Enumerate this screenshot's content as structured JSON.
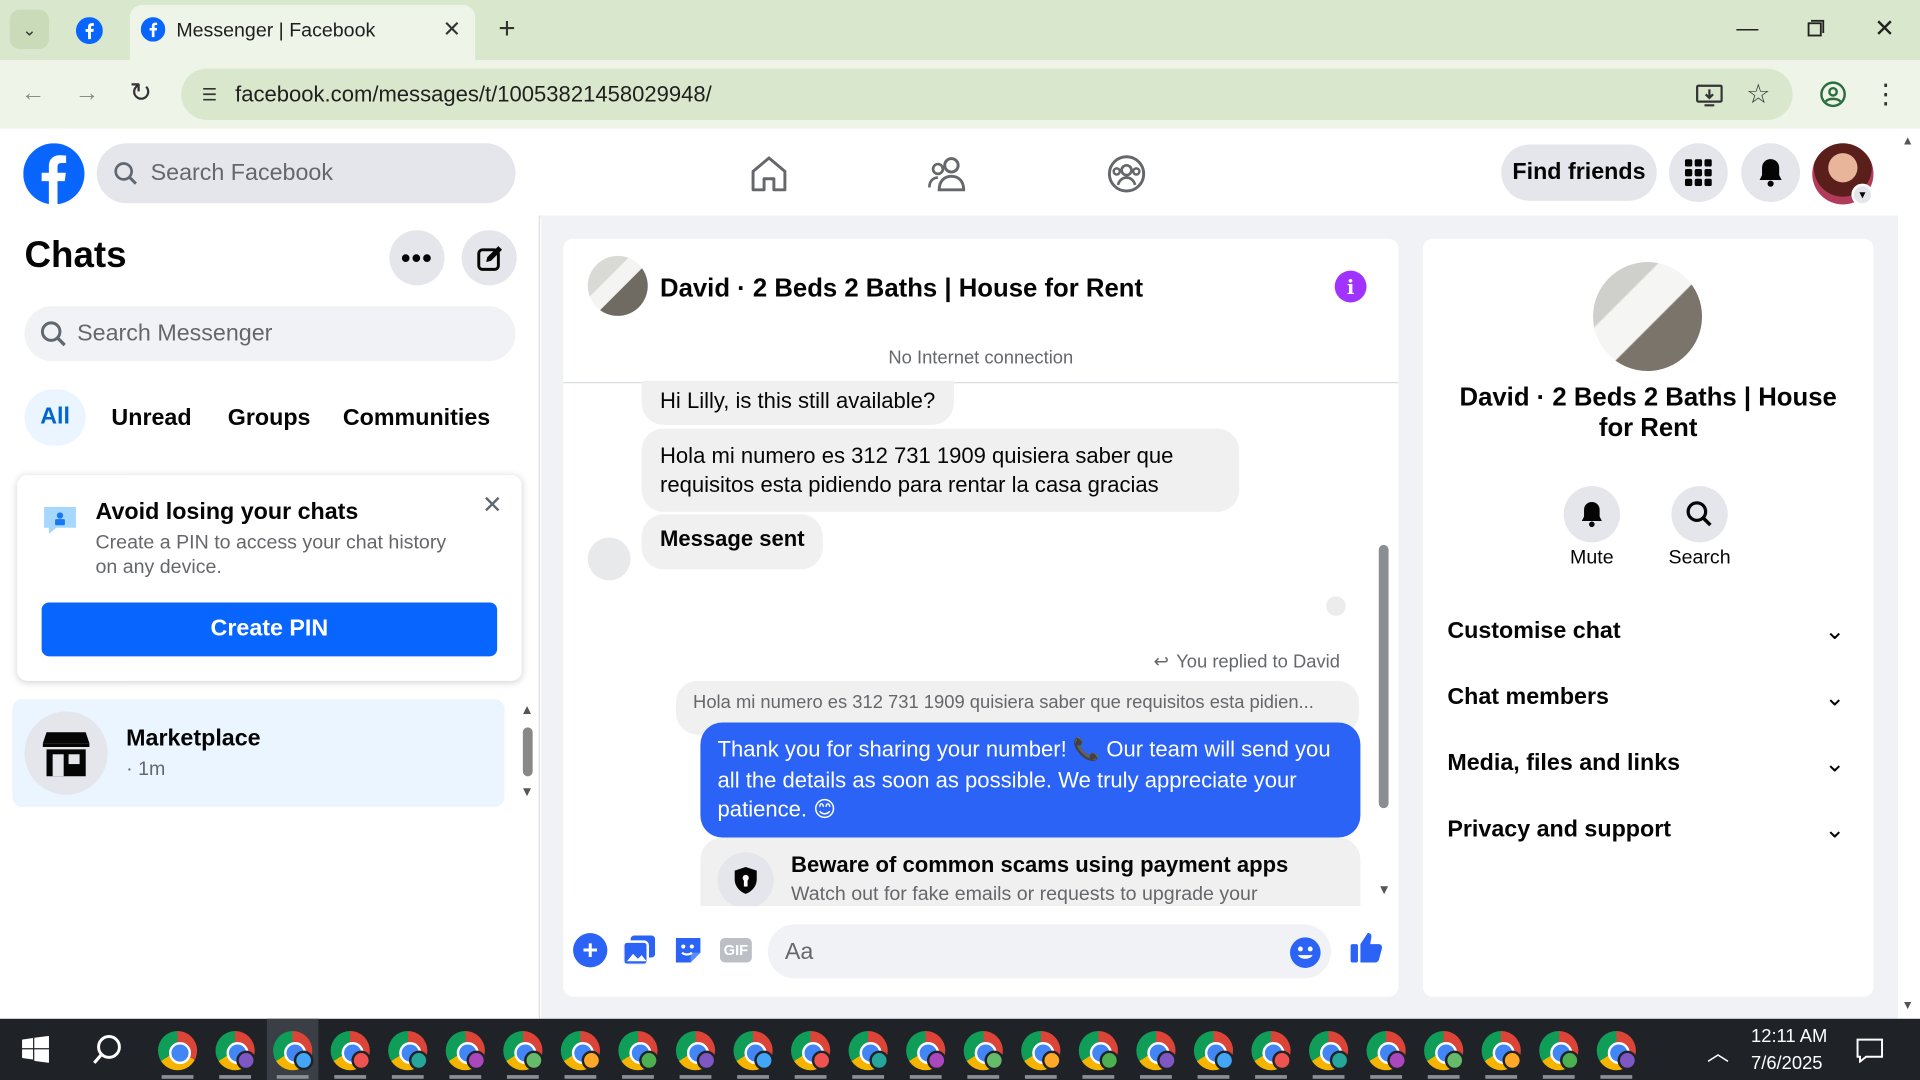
{
  "browser": {
    "tab_title": "Messenger | Facebook",
    "url": "facebook.com/messages/t/10053821458029948/"
  },
  "fb": {
    "search_placeholder": "Search Facebook",
    "find_friends": "Find friends"
  },
  "chats": {
    "title": "Chats",
    "search_placeholder": "Search Messenger",
    "filters": [
      "All",
      "Unread",
      "Groups",
      "Communities"
    ],
    "pin_card": {
      "title": "Avoid losing your chats",
      "body": "Create a PIN to access your chat history on any device.",
      "button": "Create PIN"
    },
    "items": [
      {
        "name": "Marketplace",
        "meta": "· 1m"
      }
    ]
  },
  "conversation": {
    "title": "David · 2 Beds 2 Baths | House for Rent",
    "status": "No Internet connection",
    "messages": [
      {
        "from": "them",
        "text": "Hi Lilly, is this still available?"
      },
      {
        "from": "them",
        "text": "Hola mi numero es 312 731 1909 quisiera saber que requisitos esta pidiendo para rentar la casa gracias"
      },
      {
        "from": "them",
        "text": "Message sent"
      }
    ],
    "reply_label": "You replied to David",
    "reply_quote": "Hola mi numero es 312 731 1909 quisiera saber que requisitos esta pidien...",
    "my_message": "Thank you for sharing your number! 📞 Our team will send you all the details as soon as possible. We truly appreciate your patience. 😊",
    "notice": {
      "title": "Beware of common scams using payment apps",
      "body": "Watch out for fake emails or requests to upgrade your"
    },
    "composer_placeholder": "Aa"
  },
  "info_panel": {
    "name": "David · 2 Beds 2 Baths | House for Rent",
    "actions": [
      "Mute",
      "Search"
    ],
    "sections": [
      "Customise chat",
      "Chat members",
      "Media, files and links",
      "Privacy and support"
    ]
  },
  "taskbar": {
    "time": "12:11 AM",
    "date": "7/6/2025"
  },
  "colors": {
    "fb_blue": "#0866ff",
    "messenger_purple": "#a033ff",
    "my_bubble": "#2a63f6"
  }
}
